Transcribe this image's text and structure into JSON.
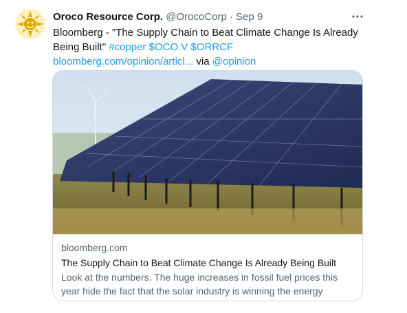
{
  "tweet": {
    "display_name": "Oroco Resource Corp.",
    "handle": "@OrocoCorp",
    "separator": "·",
    "date": "Sep 9",
    "more_icon": "more-horizontal-icon",
    "text_prefix": "Bloomberg - \"The Supply Chain to Beat Climate Change Is Already Being Built\" ",
    "hashtag": "#copper",
    "cashtag_1": "$OCO.V",
    "cashtag_2": "$ORRCF",
    "url": "bloomberg.com/opinion/articl...",
    "via_text": "via",
    "via_mention": "@opinion"
  },
  "card": {
    "domain": "bloomberg.com",
    "title": "The Supply Chain to Beat Climate Change Is Already Being Built",
    "description": "Look at the numbers. The huge increases in fossil fuel prices this year hide the fact that the solar industry is winning the energy transition."
  },
  "colors": {
    "link": "#1d9bf0",
    "secondary_text": "#536471",
    "primary_text": "#0f1419",
    "border": "#cfd9de"
  }
}
